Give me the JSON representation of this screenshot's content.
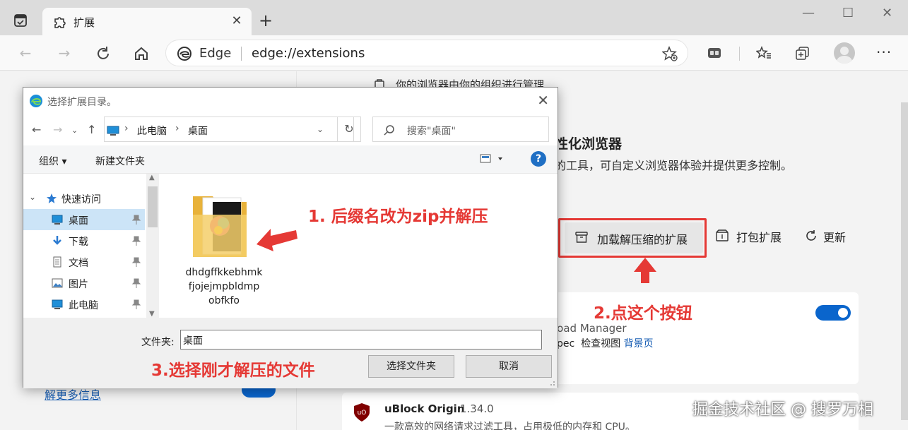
{
  "browser": {
    "tab_title": "扩展",
    "tab_close": "✕",
    "new_tab": "+",
    "brand": "Edge",
    "url": "edge://extensions"
  },
  "page": {
    "managed_notice": "你的浏览器由你的组织进行管理",
    "heading": "性化浏览器",
    "subtext": "的工具，可自定义浏览器体验并提供更多控制。",
    "load_unpacked_label": "加载解压缩的扩展",
    "pack_label": "打包扩展",
    "update_label": "更新",
    "learn_more": "解更多信息",
    "card1": {
      "name_partial": "load Manager",
      "meta_partial": "pec",
      "inspect": "检查视图",
      "bg_page": "背景页"
    },
    "card2": {
      "name": "uBlock Origin",
      "version": "1.34.0",
      "desc": "一款高效的网络请求过滤工具，占用极低的内存和 CPU。"
    }
  },
  "dialog": {
    "title": "选择扩展目录。",
    "close": "✕",
    "crumbs": [
      "此电脑",
      "桌面"
    ],
    "search_placeholder": "搜索\"桌面\"",
    "organize": "组织 ▾",
    "new_folder": "新建文件夹",
    "help": "?",
    "tree": [
      {
        "label": "快速访问",
        "icon": "star-icon",
        "selected": false,
        "pinned": false
      },
      {
        "label": "桌面",
        "icon": "desktop-icon",
        "selected": true,
        "pinned": true
      },
      {
        "label": "下载",
        "icon": "download-icon",
        "selected": false,
        "pinned": true
      },
      {
        "label": "文档",
        "icon": "document-icon",
        "selected": false,
        "pinned": true
      },
      {
        "label": "图片",
        "icon": "picture-icon",
        "selected": false,
        "pinned": true
      },
      {
        "label": "此电脑",
        "icon": "computer-icon",
        "selected": false,
        "pinned": true
      }
    ],
    "file_name": "dhdgffkkebhmkfjojejmpbldmpobfkfo",
    "file_lines": [
      "dhdgffkkebhmk",
      "fjojejmpbldmp",
      "obfkfo"
    ],
    "folder_label": "文件夹:",
    "folder_value": "桌面",
    "select_btn": "选择文件夹",
    "cancel_btn": "取消"
  },
  "annotations": {
    "step1": "1. 后缀名改为zip并解压",
    "step2": "2.点这个按钮",
    "step3": "3.选择刚才解压的文件"
  },
  "watermark": "掘金技术社区 @ 搜罗万相",
  "colors": {
    "accent_blue": "#0a65cc",
    "annotation_red": "#e53935"
  }
}
